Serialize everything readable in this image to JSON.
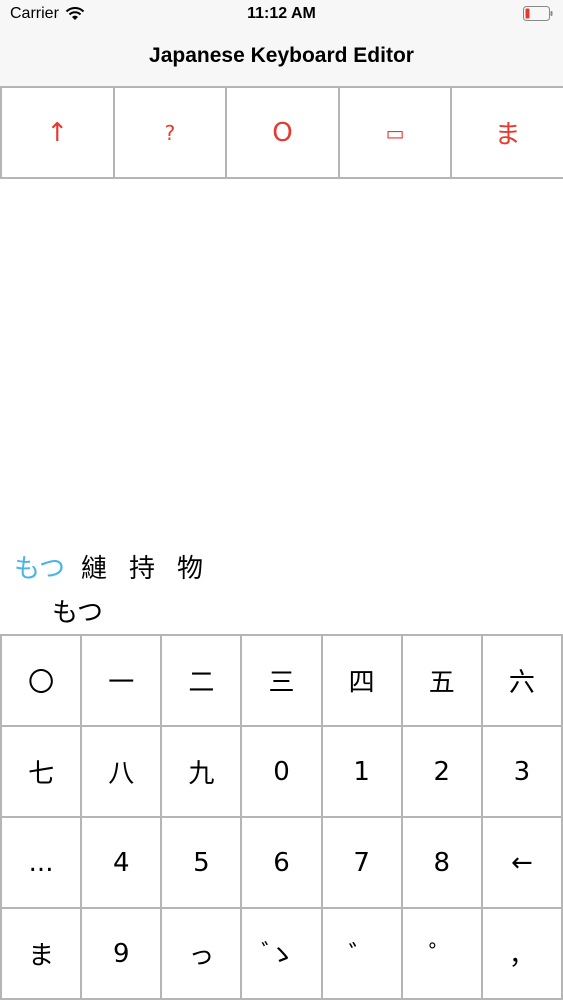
{
  "status_bar": {
    "carrier": "Carrier",
    "time": "11:12 AM",
    "wifi_icon": "wifi-icon",
    "battery_icon": "battery-low-icon",
    "battery_color": "#e53a30"
  },
  "nav": {
    "title": "Japanese Keyboard Editor"
  },
  "toolbar": {
    "accent_color": "#e53a30",
    "buttons": [
      {
        "label": "↑",
        "name": "shift-button"
      },
      {
        "label": "?",
        "name": "help-button"
      },
      {
        "label": "O",
        "name": "o-button"
      },
      {
        "label": "▭",
        "name": "box-button"
      },
      {
        "label": "ま",
        "name": "ma-button"
      }
    ]
  },
  "candidates": {
    "selected_color": "#4ab4e6",
    "items": [
      "もつ",
      "縺",
      "持",
      "物"
    ],
    "composing": "もつ"
  },
  "keyboard": {
    "rows": [
      [
        "〇",
        "一",
        "二",
        "三",
        "四",
        "五",
        "六"
      ],
      [
        "七",
        "八",
        "九",
        "0",
        "1",
        "2",
        "3"
      ],
      [
        "...",
        "4",
        "5",
        "6",
        "7",
        "8",
        "←"
      ],
      [
        "ま",
        "9",
        "っ",
        "゙ゝ",
        "゛",
        "゜",
        "，"
      ]
    ]
  }
}
